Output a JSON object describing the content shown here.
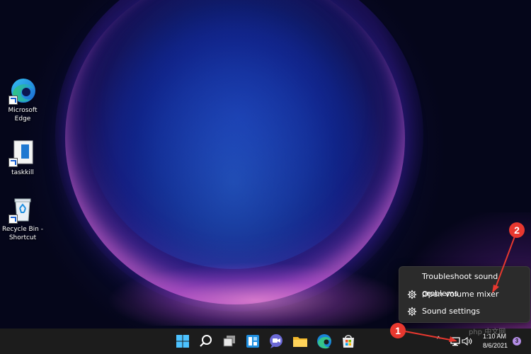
{
  "desktop": {
    "icons": [
      {
        "label_line1": "Microsoft",
        "label_line2": "Edge",
        "icon": "edge-icon"
      },
      {
        "label_line1": "taskkill",
        "label_line2": "",
        "icon": "file-icon"
      },
      {
        "label_line1": "Recycle Bin -",
        "label_line2": "Shortcut",
        "icon": "recycle-bin-icon"
      }
    ]
  },
  "context_menu": {
    "items": [
      {
        "label": "Troubleshoot sound problems",
        "icon": ""
      },
      {
        "label": "Open volume mixer",
        "icon": "gear-icon"
      },
      {
        "label": "Sound settings",
        "icon": "gear-icon"
      }
    ]
  },
  "callouts": {
    "first": "1",
    "second": "2"
  },
  "taskbar": {
    "apps": [
      "start-icon",
      "search-icon",
      "task-view-icon",
      "widgets-icon",
      "chat-icon",
      "file-explorer-icon",
      "edge-icon",
      "store-icon"
    ],
    "tray": {
      "time": "1:10 AM",
      "date": "8/6/2021",
      "notification_count": "3",
      "chevron": "^"
    }
  },
  "colors": {
    "accent": "#e8382f",
    "taskbar": "#1c1c1c",
    "menu": "#2b2b2b"
  },
  "watermark": "php 中文网"
}
